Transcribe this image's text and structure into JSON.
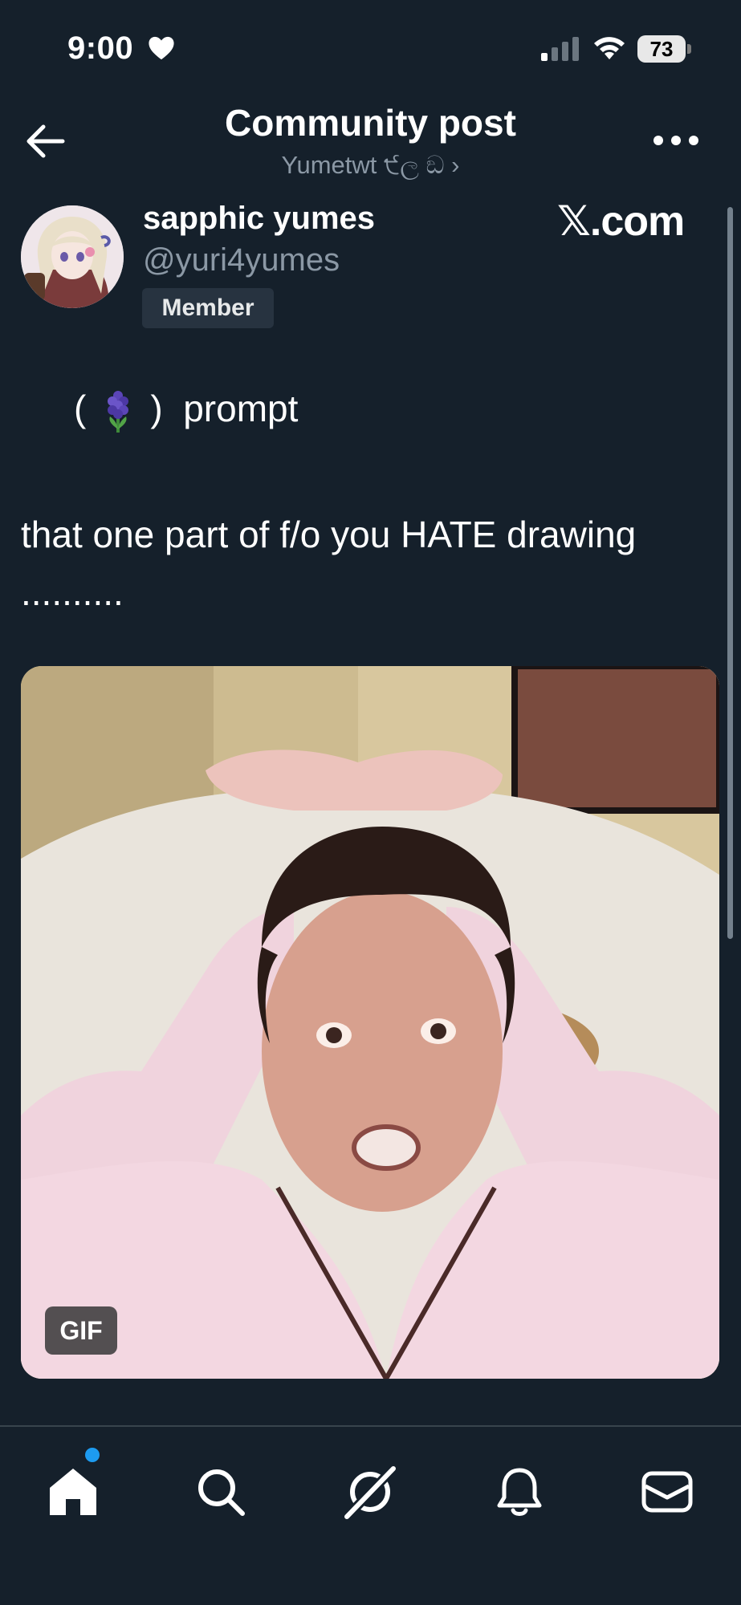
{
  "status_bar": {
    "time": "9:00",
    "battery": "73"
  },
  "header": {
    "title": "Community post",
    "subtitle": "Yumetwt ੯ල ඞ ›"
  },
  "post": {
    "author": {
      "display_name": "sapphic yumes",
      "handle": "@yuri4yumes",
      "badge": "Member"
    },
    "watermark": "𝕏.com",
    "prompt_open": "(",
    "prompt_close": ")  prompt",
    "body": "that one part of f/o you HATE drawing ..........",
    "media": {
      "type": "gif",
      "badge": "GIF"
    }
  },
  "nav": {
    "items": [
      {
        "name": "home",
        "icon": "home-icon",
        "active": true,
        "notification_dot": true
      },
      {
        "name": "search",
        "icon": "search-icon"
      },
      {
        "name": "grok",
        "icon": "grok-icon"
      },
      {
        "name": "notifications",
        "icon": "bell-icon"
      },
      {
        "name": "messages",
        "icon": "mail-icon"
      }
    ]
  },
  "colors": {
    "background": "#15202b",
    "secondary_text": "#8b98a5",
    "accent": "#1d9bf0",
    "badge_bg": "#273340"
  }
}
